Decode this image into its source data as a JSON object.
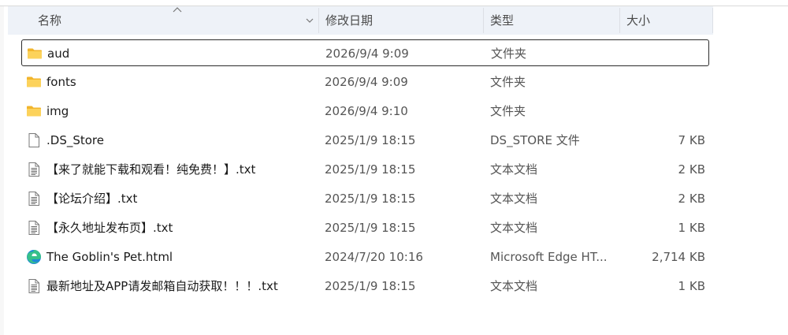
{
  "columns": {
    "name": "名称",
    "date": "修改日期",
    "type": "类型",
    "size": "大小"
  },
  "files": [
    {
      "name": "aud",
      "date": "2026/9/4 9:09",
      "type": "文件夹",
      "size": "",
      "icon": "folder-icon",
      "selected": true
    },
    {
      "name": "fonts",
      "date": "2026/9/4 9:09",
      "type": "文件夹",
      "size": "",
      "icon": "folder-icon"
    },
    {
      "name": "img",
      "date": "2026/9/4 9:10",
      "type": "文件夹",
      "size": "",
      "icon": "folder-icon"
    },
    {
      "name": ".DS_Store",
      "date": "2025/1/9 18:15",
      "type": "DS_STORE 文件",
      "size": "7 KB",
      "icon": "blank-file-icon"
    },
    {
      "name": "【来了就能下载和观看！纯免费！】.txt",
      "date": "2025/1/9 18:15",
      "type": "文本文档",
      "size": "2 KB",
      "icon": "text-file-icon"
    },
    {
      "name": "【论坛介绍】.txt",
      "date": "2025/1/9 18:15",
      "type": "文本文档",
      "size": "2 KB",
      "icon": "text-file-icon"
    },
    {
      "name": "【永久地址发布页】.txt",
      "date": "2025/1/9 18:15",
      "type": "文本文档",
      "size": "1 KB",
      "icon": "text-file-icon"
    },
    {
      "name": "The Goblin's Pet.html",
      "date": "2024/7/20 10:16",
      "type": "Microsoft Edge HT...",
      "size": "2,714 KB",
      "icon": "edge-html-icon"
    },
    {
      "name": "最新地址及APP请发邮箱自动获取！！！.txt",
      "date": "2025/1/9 18:15",
      "type": "文本文档",
      "size": "1 KB",
      "icon": "text-file-icon"
    }
  ]
}
